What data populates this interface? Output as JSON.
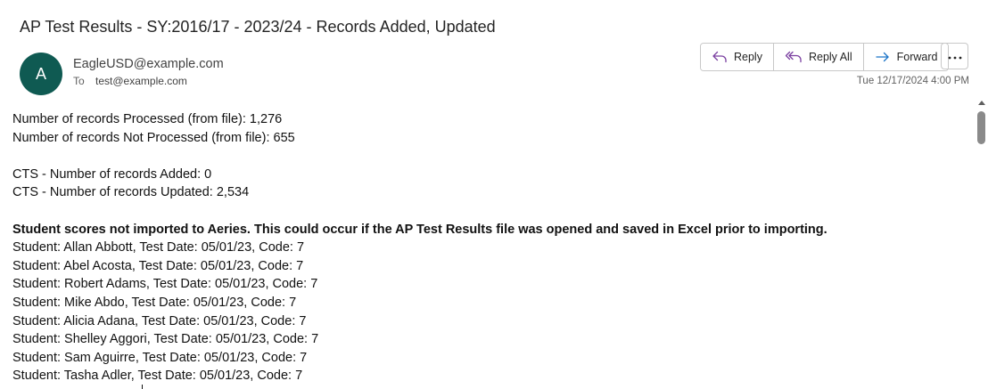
{
  "email": {
    "subject": "AP Test Results - SY:2016/17 - 2023/24 - Records Added, Updated",
    "avatar_initial": "A",
    "avatar_color": "#0f5a52",
    "sender": "EagleUSD@example.com",
    "to_label": "To",
    "recipient": "test@example.com",
    "timestamp": "Tue 12/17/2024 4:00 PM"
  },
  "actions": {
    "reply_label": "Reply",
    "reply_all_label": "Reply All",
    "forward_label": "Forward",
    "more_icon": "ellipsis-icon"
  },
  "body": {
    "processed": "Number of records Processed (from file): 1,276",
    "not_processed": "Number of records Not Processed (from file): 655",
    "cts_added": "CTS - Number of records Added: 0",
    "cts_updated": "CTS - Number of records Updated: 2,534",
    "warning": "Student scores not imported to Aeries. This could occur if the AP Test Results file was opened and saved in Excel prior to importing.",
    "students": [
      "Student: Allan Abbott, Test Date: 05/01/23, Code: 7",
      "Student: Abel Acosta, Test Date: 05/01/23, Code: 7",
      "Student: Robert Adams, Test Date: 05/01/23, Code: 7",
      "Student: Mike Abdo, Test Date: 05/01/23, Code: 7",
      "Student: Alicia Adana, Test Date: 05/01/23, Code: 7",
      "Student: Shelley Aggori, Test Date: 05/01/23, Code: 7",
      "Student: Sam Aguirre, Test Date: 05/01/23, Code: 7",
      "Student: Tasha Adler, Test Date: 05/01/23, Code: 7"
    ]
  }
}
